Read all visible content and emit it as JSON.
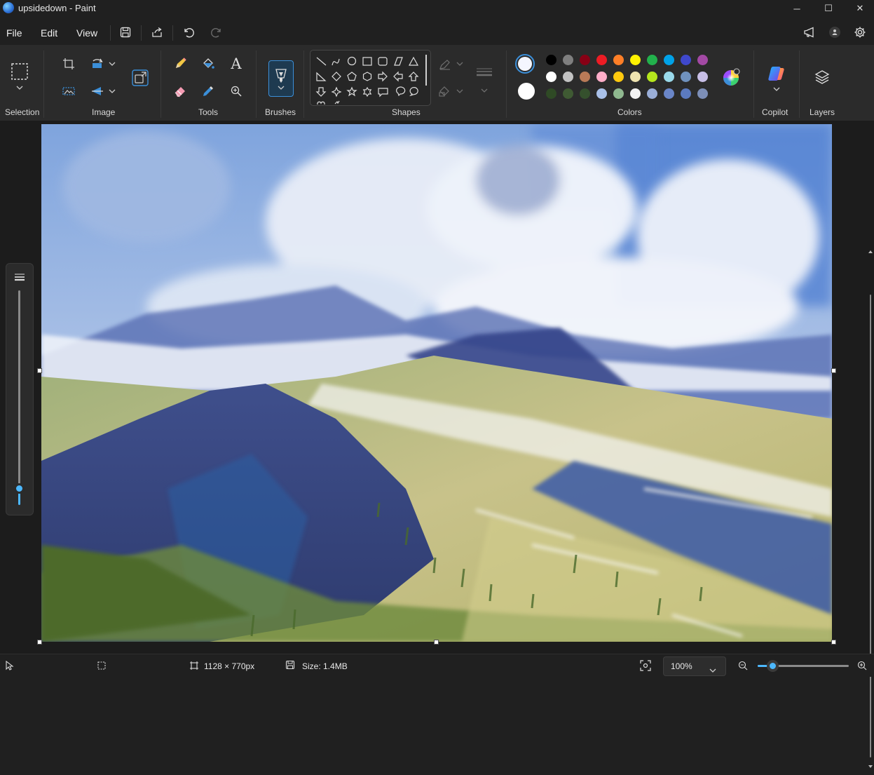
{
  "window": {
    "title": "upsidedown - Paint",
    "minimize_glyph": "─",
    "maximize_glyph": "☐",
    "close_glyph": "✕"
  },
  "menu": {
    "items": [
      "File",
      "Edit",
      "View"
    ]
  },
  "ribbon": {
    "groups": {
      "selection": "Selection",
      "image": "Image",
      "tools": "Tools",
      "brushes": "Brushes",
      "shapes": "Shapes",
      "colors": "Colors",
      "copilot": "Copilot",
      "layers": "Layers"
    },
    "text_tool_glyph": "A",
    "primary_color": "#f4f6ff",
    "secondary_color": "#ffffff",
    "palette": [
      [
        "#000000",
        "#7f7f7f",
        "#880015",
        "#ed1c24",
        "#ff7f27",
        "#fff200",
        "#22b14c",
        "#00a2e8",
        "#3f48cc",
        "#a349a4"
      ],
      [
        "#ffffff",
        "#c3c3c3",
        "#b97a57",
        "#ffaec9",
        "#ffc90e",
        "#efe4b0",
        "#b5e61d",
        "#99d9ea",
        "#7092be",
        "#c8bfe7"
      ],
      [
        "#2f4a25",
        "#3f5a33",
        "#35502d",
        "#a9c0e8",
        "#8fb88f",
        "#f2f2f2",
        "#9aaed8",
        "#6a86c8",
        "#5b7ac0",
        "#7d8fb8"
      ]
    ]
  },
  "status": {
    "dimensions": "1128 × 770px",
    "size": "Size: 1.4MB",
    "zoom": "100%"
  }
}
